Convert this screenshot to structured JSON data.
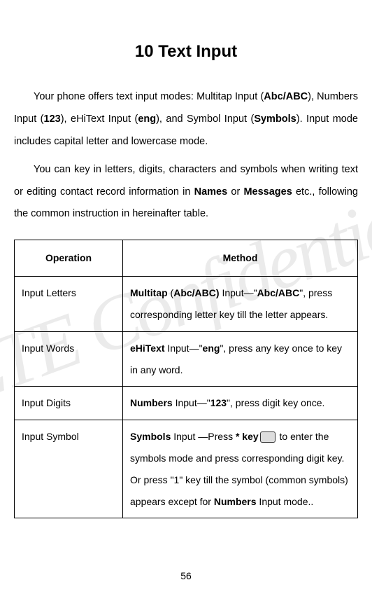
{
  "watermark": "ZTE Confidential",
  "title": "10  Text Input",
  "intro": {
    "p1_parts": [
      {
        "text": "Your phone offers text input modes: Multitap Input ("
      },
      {
        "text": "Abc/ABC",
        "bold": true
      },
      {
        "text": "), Numbers Input ("
      },
      {
        "text": "123",
        "bold": true
      },
      {
        "text": "), eHiText Input ("
      },
      {
        "text": "eng",
        "bold": true
      },
      {
        "text": "), and Symbol Input ("
      },
      {
        "text": "Symbols",
        "bold": true
      },
      {
        "text": "). Input mode includes capital letter and lowercase mode."
      }
    ],
    "p2_parts": [
      {
        "text": "You can key in letters, digits, characters and symbols when writing text or editing contact record information in "
      },
      {
        "text": "Names",
        "bold": true
      },
      {
        "text": " or "
      },
      {
        "text": "Messages",
        "bold": true
      },
      {
        "text": " etc., following the common instruction in hereinafter table."
      }
    ]
  },
  "table": {
    "headers": {
      "col1": "Operation",
      "col2": "Method"
    },
    "rows": [
      {
        "operation": "Input Letters",
        "method_parts": [
          {
            "text": "Multitap",
            "bold": true
          },
          {
            "text": " ("
          },
          {
            "text": "Abc/ABC)",
            "bold": true
          },
          {
            "text": " Input—\""
          },
          {
            "text": "Abc/ABC",
            "bold": true
          },
          {
            "text": "\", press corresponding letter key till the letter appears."
          }
        ]
      },
      {
        "operation": "Input Words",
        "method_parts": [
          {
            "text": "eHiText",
            "bold": true
          },
          {
            "text": " Input—\""
          },
          {
            "text": "eng",
            "bold": true
          },
          {
            "text": "\", press any key once to key in any word."
          }
        ]
      },
      {
        "operation": "Input Digits",
        "method_parts": [
          {
            "text": "Numbers",
            "bold": true
          },
          {
            "text": " Input—\""
          },
          {
            "text": "123",
            "bold": true
          },
          {
            "text": "\", press digit key once."
          }
        ]
      },
      {
        "operation": "Input Symbol",
        "method_parts": [
          {
            "text": "Symbols",
            "bold": true
          },
          {
            "text": " Input —Press "
          },
          {
            "text": "* key",
            "bold": true
          },
          {
            "text": " ",
            "icon": true
          },
          {
            "text": " to enter the symbols mode and press corresponding digit key."
          },
          {
            "text": " Or press \"1\" key till the symbol (common symbols) appears except for "
          },
          {
            "text": "Numbers",
            "bold": true
          },
          {
            "text": " Input mode.."
          }
        ]
      }
    ]
  },
  "page_number": "56"
}
